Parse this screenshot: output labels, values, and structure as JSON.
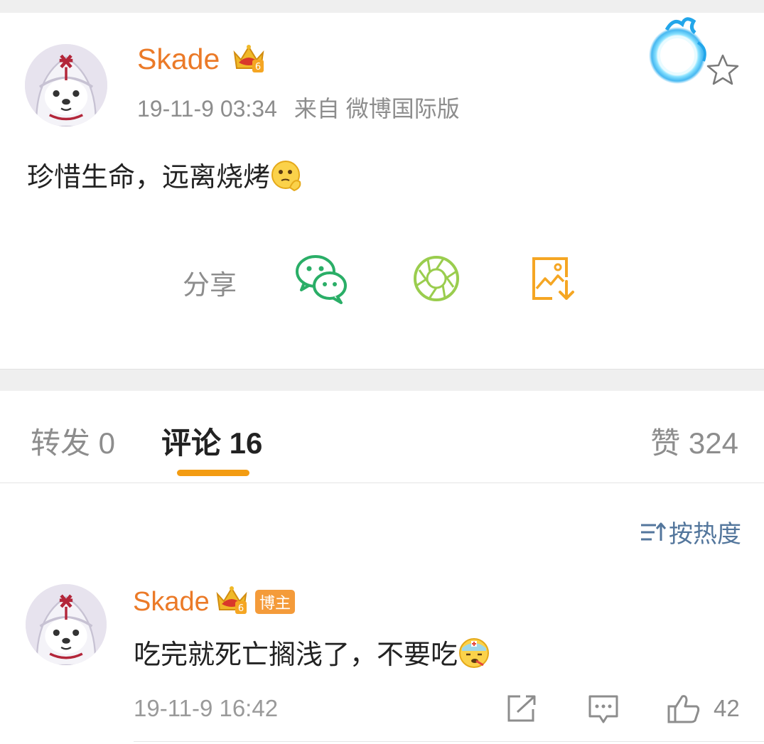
{
  "post": {
    "username": "Skade",
    "time": "19-11-9 03:34",
    "source": "来自 微博国际版",
    "text": "珍惜生命，远离烧烤"
  },
  "share": {
    "label": "分享",
    "targets": [
      {
        "name": "wechat",
        "icon": "wechat-icon"
      },
      {
        "name": "moments",
        "icon": "moments-icon"
      },
      {
        "name": "save-image",
        "icon": "save-image-icon"
      }
    ]
  },
  "tabs": {
    "repost": "转发 0",
    "comment": "评论 16",
    "like": "赞 324",
    "active": "comment"
  },
  "sort": {
    "label": "按热度"
  },
  "comments": [
    {
      "username": "Skade",
      "badge": "博主",
      "text": "吃完就死亡搁浅了，不要吃",
      "time": "19-11-9 16:42",
      "likes": "42"
    }
  ],
  "colors": {
    "username": "#eb7a28",
    "accent": "#f39c12",
    "link": "#53769c",
    "wechat": "#2aae67",
    "moments": "#9acd4e",
    "save": "#f5a623"
  }
}
